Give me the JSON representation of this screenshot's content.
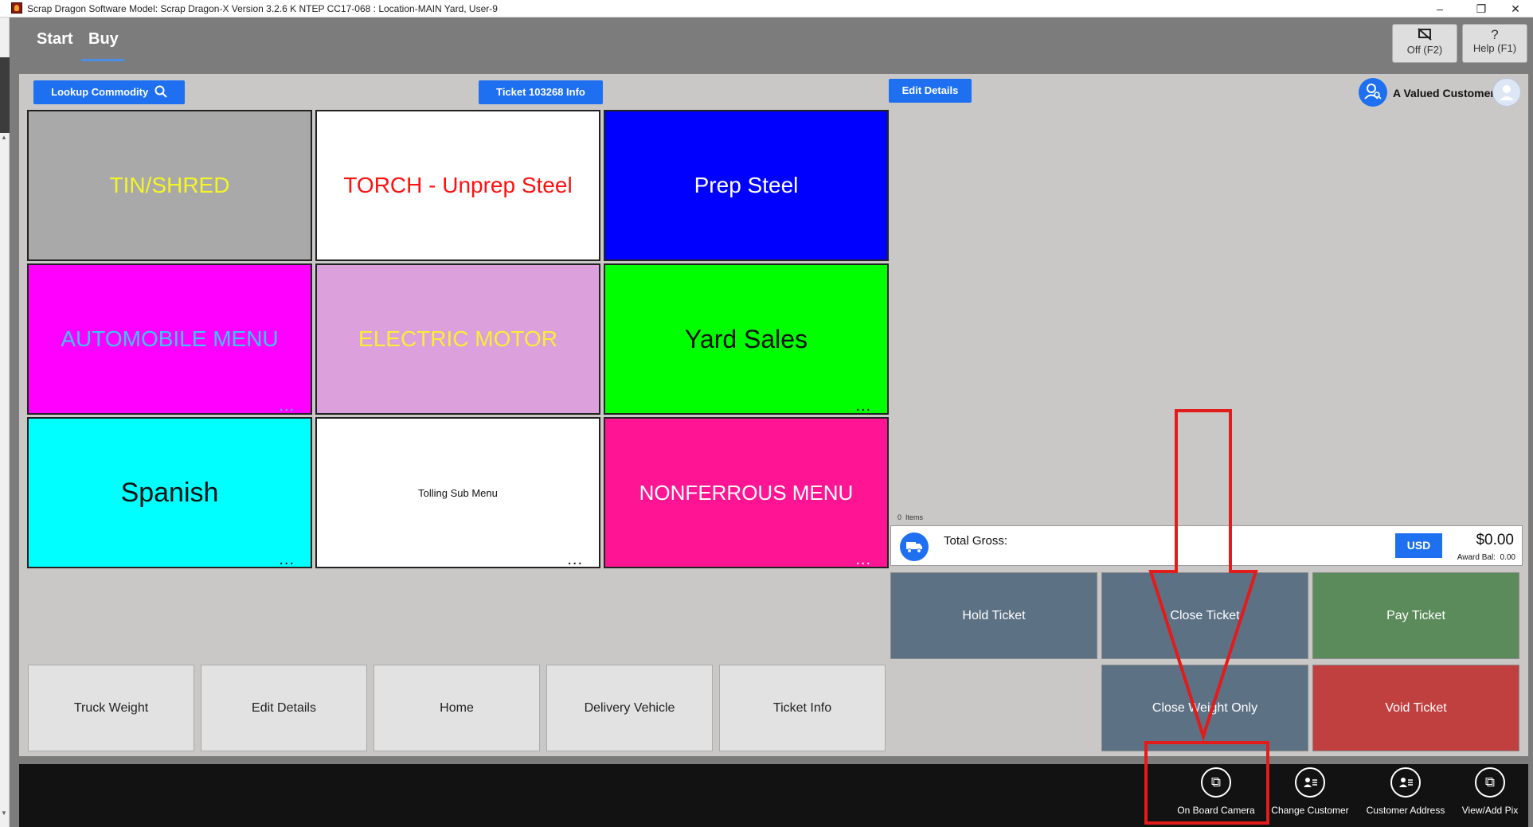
{
  "titlebar": {
    "title": "Scrap Dragon Software Model: Scrap Dragon-X Version 3.2.6 K NTEP CC17-068 : Location-MAIN Yard, User-9",
    "minimize": "–",
    "restore": "❐",
    "close": "✕"
  },
  "header": {
    "tabs": [
      "Start",
      "Buy"
    ],
    "off_label": "Off (F2)",
    "help_label": "Help (F1)",
    "help_icon": "?"
  },
  "toolbar": {
    "lookup_label": "Lookup Commodity",
    "ticket_info_label": "Ticket 103268 Info",
    "edit_details_label": "Edit Details",
    "customer_name": "A Valued Customer"
  },
  "tiles": [
    {
      "label": "TIN/SHRED",
      "bg": "#a9a9a9",
      "fg": "#f4f428",
      "dots": false
    },
    {
      "label": "TORCH - Unprep Steel",
      "bg": "#ffffff",
      "fg": "#ff1010",
      "dots": false
    },
    {
      "label": "Prep Steel",
      "bg": "#0000ff",
      "fg": "#ffffff",
      "dots": false
    },
    {
      "label": "AUTOMOBILE MENU",
      "bg": "#ff00ff",
      "fg": "#35c8ff",
      "dots": true
    },
    {
      "label": "ELECTRIC MOTOR",
      "bg": "#dca0dc",
      "fg": "#f8ee38",
      "dots": false
    },
    {
      "label": "Yard Sales",
      "bg": "#00ff00",
      "fg": "#111111",
      "dots": true
    },
    {
      "label": "Spanish",
      "bg": "#00ffff",
      "fg": "#111111",
      "dots": true
    },
    {
      "label": "Tolling Sub Menu",
      "bg": "#ffffff",
      "fg": "#111111",
      "dots": true
    },
    {
      "label": "NONFERROUS MENU",
      "bg": "#ff1493",
      "fg": "#ffffff",
      "dots": true
    }
  ],
  "more_glyph": "...",
  "bottom_buttons": [
    "Truck Weight",
    "Edit Details",
    "Home",
    "Delivery Vehicle",
    "Ticket Info"
  ],
  "summary": {
    "items_count": "0",
    "items_label": "Items",
    "total_label": "Total Gross:",
    "currency": "USD",
    "amount": "$0.00",
    "award_label": "Award Bal:",
    "award_value": "0.00"
  },
  "actions": [
    {
      "label": "Hold Ticket",
      "bg": "#5d7185"
    },
    {
      "label": "Close Ticket",
      "bg": "#5d7185"
    },
    {
      "label": "Pay Ticket",
      "bg": "#5b8b5b"
    },
    {
      "label": "Close Weight Only",
      "bg": "#5d7185"
    },
    {
      "label": "Void Ticket",
      "bg": "#c04040"
    }
  ],
  "footer": [
    "On Board Camera",
    "Change Customer",
    "Customer Address",
    "View/Add Pix"
  ],
  "annotation_color": "#e21b1b"
}
